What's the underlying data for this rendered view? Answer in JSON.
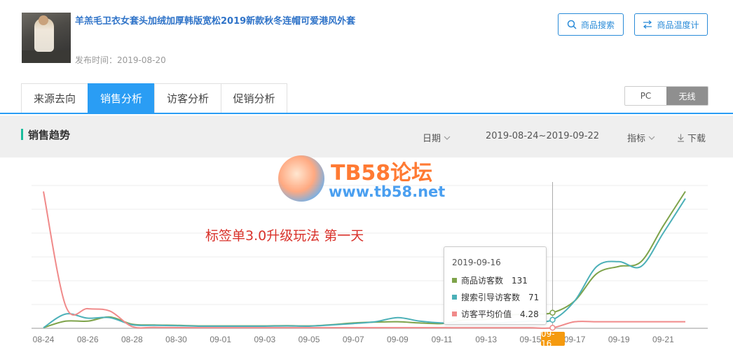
{
  "product": {
    "title": "羊羔毛卫衣女套头加绒加厚韩版宽松2019新款秋冬连帽可爱港风外套",
    "publish_time": "发布时间：2019-08-20",
    "thumbnail": "product-photo"
  },
  "header_buttons": {
    "search_label": "商品搜索",
    "temp_label": "商品温度计",
    "accent_color": "#2a8bd8"
  },
  "tabs": [
    {
      "label": "来源去向",
      "active": false
    },
    {
      "label": "销售分析",
      "active": true
    },
    {
      "label": "访客分析",
      "active": false
    },
    {
      "label": "促销分析",
      "active": false
    }
  ],
  "device_toggle": {
    "pc_label": "PC",
    "wireless_label": "无线",
    "selected": "无线"
  },
  "section": {
    "title": "销售趋势",
    "date_label": "日期",
    "date_range": "2019-08-24~2019-09-22",
    "metric_label": "指标",
    "download_label": "下载"
  },
  "watermark": {
    "title": "TB58论坛",
    "url": "www.tb58.net"
  },
  "annotation": "标签单3.0升级玩法  第一天",
  "tooltip": {
    "date": "2019-09-16",
    "rows": [
      {
        "label": "商品访客数",
        "value": "131",
        "color": "#7ea34a"
      },
      {
        "label": "搜索引导访客数",
        "value": "71",
        "color": "#4cb0b8"
      },
      {
        "label": "访客平均价值",
        "value": "4.28",
        "color": "#f08a8a"
      }
    ]
  },
  "chart_data": {
    "type": "line",
    "x": [
      "08-24",
      "08-25",
      "08-26",
      "08-27",
      "08-28",
      "08-29",
      "08-30",
      "08-31",
      "09-01",
      "09-02",
      "09-03",
      "09-04",
      "09-05",
      "09-06",
      "09-07",
      "09-08",
      "09-09",
      "09-10",
      "09-11",
      "09-12",
      "09-13",
      "09-14",
      "09-15",
      "09-16",
      "09-17",
      "09-18",
      "09-19",
      "09-20",
      "09-21",
      "09-22"
    ],
    "x_tick_labels": [
      "08-24",
      "08-26",
      "08-28",
      "08-30",
      "09-01",
      "09-03",
      "09-05",
      "09-07",
      "09-09",
      "09-11",
      "09-13",
      "09-15",
      "09-16",
      "09-17",
      "09-19",
      "09-21"
    ],
    "highlight_x": "09-16",
    "series": [
      {
        "name": "商品访客数",
        "color": "#7ea34a",
        "values": [
          5,
          60,
          60,
          95,
          35,
          28,
          25,
          20,
          20,
          20,
          20,
          22,
          20,
          30,
          45,
          52,
          55,
          45,
          40,
          70,
          75,
          110,
          120,
          131,
          230,
          460,
          520,
          560,
          860,
          1150
        ]
      },
      {
        "name": "搜索引导访客数",
        "color": "#4cb0b8",
        "values": [
          5,
          120,
          85,
          90,
          30,
          25,
          22,
          18,
          18,
          18,
          18,
          20,
          18,
          28,
          40,
          55,
          90,
          60,
          45,
          45,
          40,
          50,
          60,
          71,
          230,
          520,
          560,
          520,
          800,
          1090
        ]
      },
      {
        "name": "访客平均价值",
        "color": "#f08a8a",
        "values": [
          1150,
          190,
          165,
          145,
          15,
          8,
          6,
          5,
          5,
          5,
          5,
          5,
          5,
          5,
          5,
          5,
          5,
          5,
          5,
          4.5,
          4.5,
          4.5,
          4.4,
          4.28,
          55,
          55,
          55,
          55,
          55,
          55
        ]
      }
    ],
    "ylim": [
      0,
      1200
    ],
    "grid": true,
    "legend": "none"
  }
}
